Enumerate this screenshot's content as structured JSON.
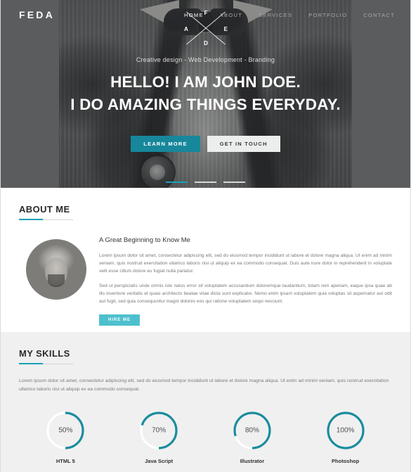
{
  "theme": {
    "accent": "#17879b",
    "accent_light": "#18a0b8",
    "hire_teal": "#4ec0cd",
    "hero_bg": "#565859",
    "skills_bg": "#f0f0f0"
  },
  "navbar": {
    "logo": "FEDA",
    "links": [
      {
        "label": "HOME",
        "active": true
      },
      {
        "label": "ABOUT",
        "active": false
      },
      {
        "label": "SERVICES",
        "active": false
      },
      {
        "label": "PORTFOLIO",
        "active": false
      },
      {
        "label": "CONTACT",
        "active": false
      }
    ]
  },
  "monogram": {
    "top": "F",
    "left": "A",
    "right": "E",
    "bottom": "D"
  },
  "hero": {
    "subtitle": "Creative design - Web Development - Branding",
    "title_line1": "HELLO! I AM JOHN DOE.",
    "title_line2": "I DO AMAZING THINGS EVERYDAY.",
    "primary_button": "LEARN MORE",
    "secondary_button": "GET IN TOUCH",
    "slides": [
      {
        "active": true
      },
      {
        "active": false
      },
      {
        "active": false
      }
    ]
  },
  "about": {
    "section_title": "ABOUT ME",
    "heading": "A Great Beginning to Know Me",
    "paragraph1": "Lorem ipsum dolor sit amet, consectetur adipiscing elit, sed do eiusmod tempor incididunt ut labore et dolore magna aliqua. Ut enim ad minim veniam, quis nostrud exercitation ullamco laboris nisi ut aliquip ex ea commodo consequat. Duis aute irure dolor in reprehenderit in voluptate velit esse cillum dolore eu fugiat nulla pariatur.",
    "paragraph2": "Sed ut perspiciatis unde omnis iste natus error sit voluptatem accusantium doloremque laudantium, totam rem aperiam, eaque ipsa quae ab illo inventore veritatis et quasi architecto beatae vitae dicta sunt explicabo. Nemo enim ipsam voluptatem quia voluptas sit aspernatur aut odit aut fugit, sed quia consequuntur magni dolores eos qui ratione voluptatem sequi nesciunt.",
    "hire_button": "HIRE ME"
  },
  "skills": {
    "section_title": "MY SKILLS",
    "paragraph": "Lorem ipsum dolor sit amet, consectetur adipiscing elit, sed do eiusmod tempor incididunt ut labore et dolore magna aliqua. Ut enim ad minim veniam, quis nostrud exercitation ullamco laboris nisi ut aliquip ex ea commodo consequat."
  },
  "chart_data": {
    "type": "pie",
    "title": "MY SKILLS",
    "categories": [
      "HTML 5",
      "Java Script",
      "Illustrator",
      "Photoshop"
    ],
    "values": [
      50,
      70,
      80,
      100
    ],
    "labels": [
      "50%",
      "70%",
      "80%",
      "100%"
    ],
    "unit": "%",
    "track_color": "#ffffff",
    "arc_color": "#1a8c9e",
    "max": 100,
    "legend": "none",
    "grid": false
  }
}
